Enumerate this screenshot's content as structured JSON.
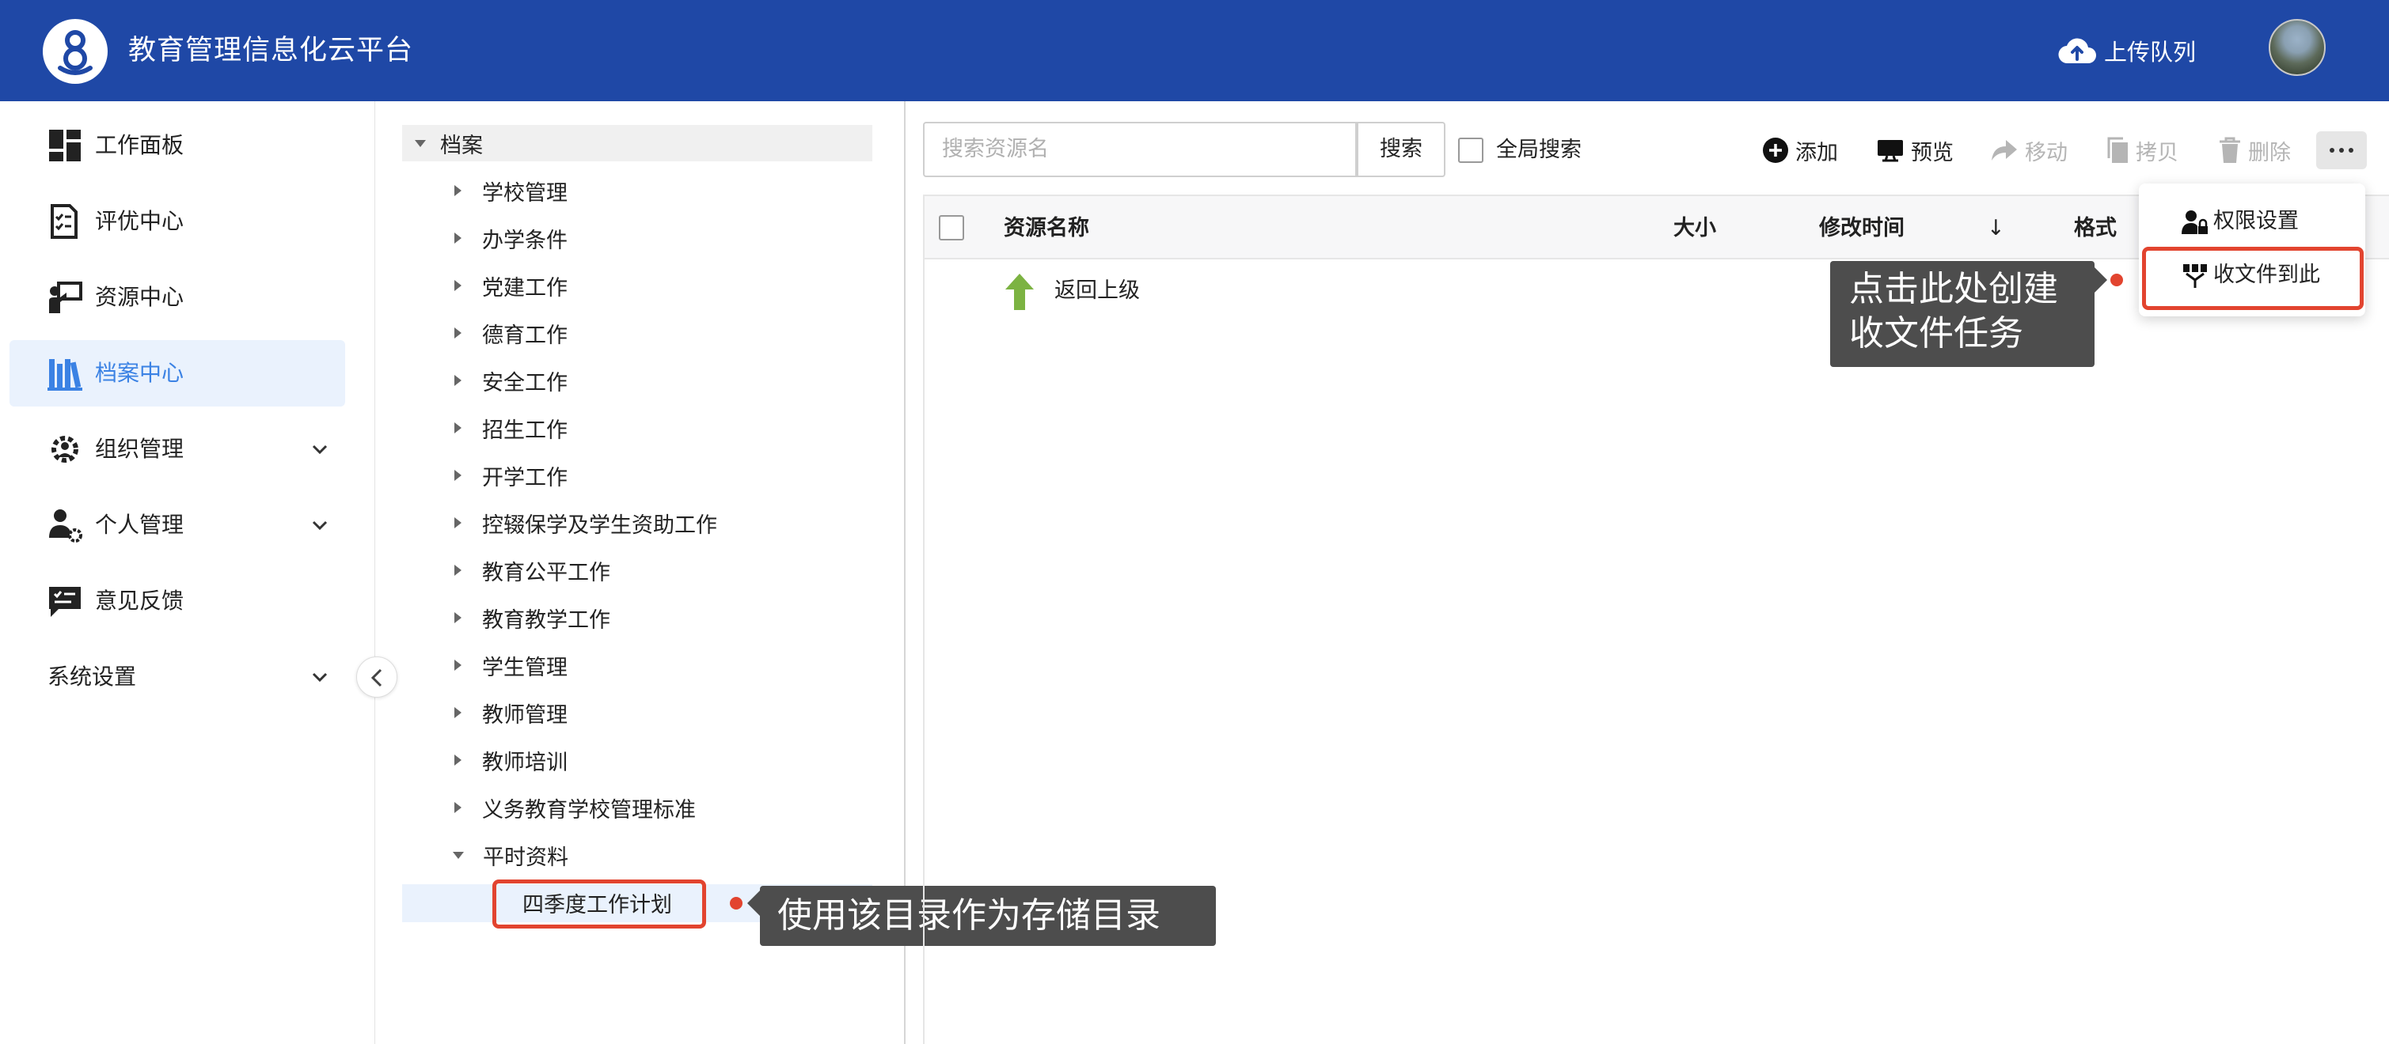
{
  "header": {
    "title": "教育管理信息化云平台",
    "upload_label": "上传队列"
  },
  "sidebar": {
    "items": [
      {
        "label": "工作面板",
        "icon": "dashboard-icon"
      },
      {
        "label": "评优中心",
        "icon": "document-check-icon"
      },
      {
        "label": "资源中心",
        "icon": "presenter-icon"
      },
      {
        "label": "档案中心",
        "icon": "archive-books-icon",
        "active": true
      },
      {
        "label": "组织管理",
        "icon": "group-gear-icon",
        "expandable": true
      },
      {
        "label": "个人管理",
        "icon": "user-gear-icon",
        "expandable": true
      },
      {
        "label": "意见反馈",
        "icon": "feedback-icon"
      }
    ],
    "system_settings": "系统设置"
  },
  "tree": {
    "root": "档案",
    "children": [
      "学校管理",
      "办学条件",
      "党建工作",
      "德育工作",
      "安全工作",
      "招生工作",
      "开学工作",
      "控辍保学及学生资助工作",
      "教育公平工作",
      "教育教学工作",
      "学生管理",
      "教师管理",
      "教师培训",
      "义务教育学校管理标准"
    ],
    "expanded_node": "平时资料",
    "selected_child": "四季度工作计划"
  },
  "toolbar": {
    "search_placeholder": "搜索资源名",
    "search_button": "搜索",
    "global_search": "全局搜索",
    "add": "添加",
    "preview": "预览",
    "move": "移动",
    "copy": "拷贝",
    "delete": "删除"
  },
  "table": {
    "columns": {
      "name": "资源名称",
      "size": "大小",
      "modified": "修改时间",
      "sort_arrow": "↓",
      "format": "格式"
    },
    "rows": [
      {
        "name": "返回上级"
      }
    ]
  },
  "dropdown": {
    "items": [
      "权限设置",
      "收文件到此"
    ]
  },
  "callouts": {
    "create_task": [
      "点击此处创建",
      "收文件任务"
    ],
    "use_dir": "使用该目录作为存储目录"
  },
  "colors": {
    "header_bg": "#1f48a6",
    "active_bg": "#eaf2fd",
    "active_text": "#3b82e4",
    "highlight_red": "#e2442f",
    "callout_bg": "#4d4d4d",
    "back_arrow_green": "#7cb342"
  }
}
